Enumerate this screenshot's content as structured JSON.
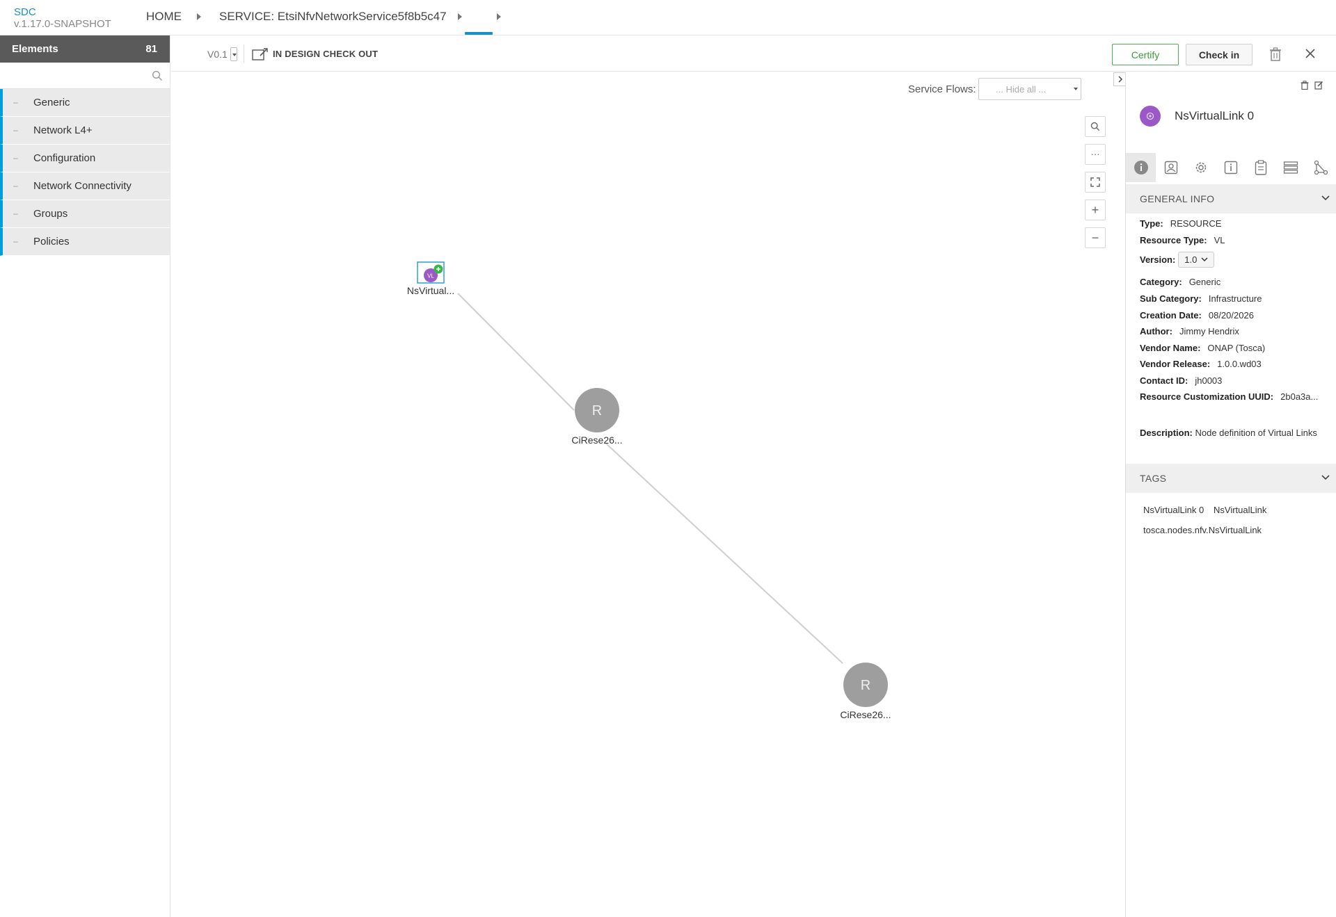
{
  "header": {
    "brand": "SDC",
    "version": "v.1.17.0-SNAPSHOT",
    "breadcrumb": [
      "HOME",
      "SERVICE: EtsiNfvNetworkService5f8b5c47"
    ]
  },
  "palette": {
    "title": "Elements",
    "count": "81",
    "search_placeholder": "",
    "categories": [
      "Generic",
      "Network L4+",
      "Configuration",
      "Network Connectivity",
      "Groups",
      "Policies"
    ]
  },
  "toolbar": {
    "version": "V0.1",
    "status": "IN DESIGN CHECK OUT",
    "certify": "Certify",
    "checkin": "Check in"
  },
  "canvas": {
    "service_flows_label": "Service Flows:",
    "service_flows_value": "... Hide all ...",
    "nodes": [
      {
        "label": "NsVirtual...",
        "badge": "VL"
      },
      {
        "label": "CiRese26...",
        "letter": "R"
      },
      {
        "label": "CiRese26...",
        "letter": "R"
      }
    ]
  },
  "details": {
    "name": "NsVirtualLink 0",
    "general_info_title": "GENERAL INFO",
    "fields": {
      "type_k": "Type:",
      "type_v": "RESOURCE",
      "rtype_k": "Resource Type:",
      "rtype_v": "VL",
      "version_k": "Version:",
      "version_v": "1.0",
      "category_k": "Category:",
      "category_v": "Generic",
      "subcat_k": "Sub Category:",
      "subcat_v": "Infrastructure",
      "date_k": "Creation Date:",
      "date_v": "08/20/2026",
      "author_k": "Author:",
      "author_v": "Jimmy Hendrix",
      "vendor_k": "Vendor Name:",
      "vendor_v": "ONAP (Tosca)",
      "release_k": "Vendor Release:",
      "release_v": "1.0.0.wd03",
      "contact_k": "Contact ID:",
      "contact_v": "jh0003",
      "uuid_k": "Resource Customization UUID:",
      "uuid_v": "2b0a3a...",
      "desc_k": "Description:",
      "desc_v": "Node definition of Virtual Links"
    },
    "tags_title": "TAGS",
    "tags": [
      "NsVirtualLink 0",
      "NsVirtualLink",
      "tosca.nodes.nfv.NsVirtualLink"
    ]
  },
  "colors": {
    "accent": "#1d8ec4",
    "certify": "#4caf50",
    "node_gray": "#9e9e9e",
    "vl_purple": "#9b59c7"
  }
}
